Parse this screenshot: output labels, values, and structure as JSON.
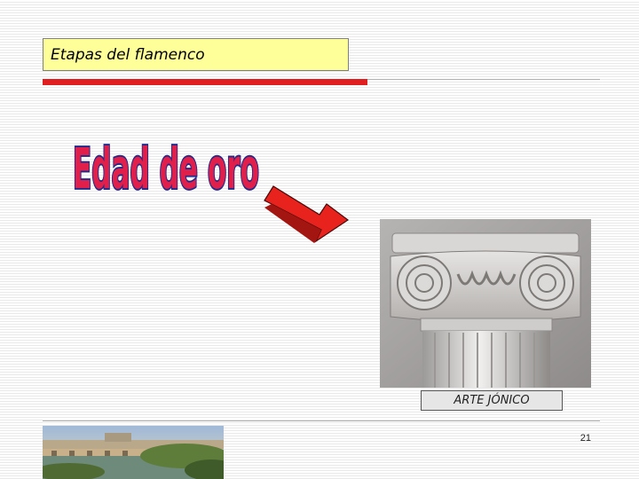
{
  "slide": {
    "title": "Etapas del flamenco",
    "headline": "Edad de oro",
    "image_caption": "ARTE JÓNICO",
    "page_number": "21"
  },
  "colors": {
    "title_background": "#ffff99",
    "accent_bar": "#e02020",
    "headline_fill": "#e0204a",
    "headline_outline": "#1e2a8a",
    "arrow_fill": "#e8231e"
  },
  "images": {
    "main": "ionic-column-capital",
    "footer": "river-bridge-landscape"
  }
}
